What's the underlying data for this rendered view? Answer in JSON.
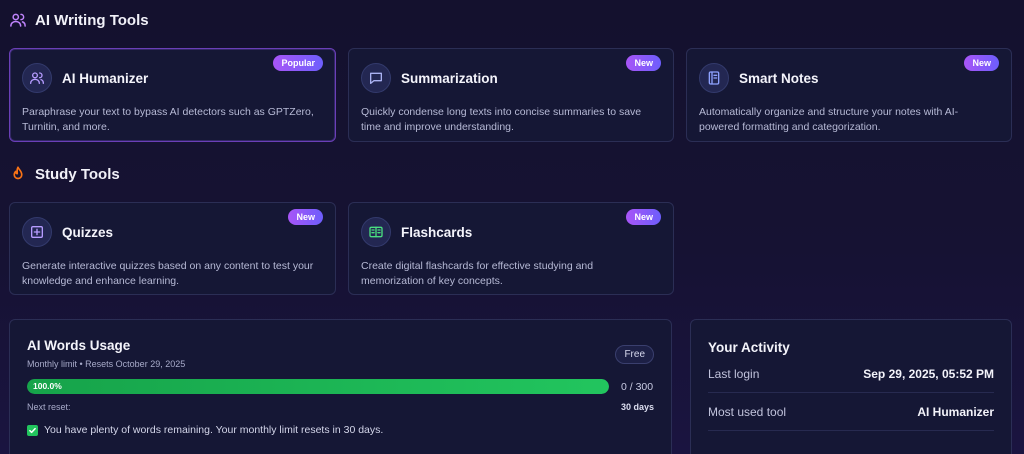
{
  "sections": {
    "writing": {
      "title": "AI Writing Tools",
      "icon": "users-icon"
    },
    "study": {
      "title": "Study Tools",
      "icon": "flame-icon"
    }
  },
  "writing_tools": [
    {
      "title": "AI Humanizer",
      "badge": "Popular",
      "icon": "users-icon",
      "description": "Paraphrase your text to bypass AI detectors such as GPTZero, Turnitin, and more."
    },
    {
      "title": "Summarization",
      "badge": "New",
      "icon": "chat-bubble-icon",
      "description": "Quickly condense long texts into concise summaries to save time and improve understanding."
    },
    {
      "title": "Smart Notes",
      "badge": "New",
      "icon": "notebook-icon",
      "description": "Automatically organize and structure your notes with AI-powered formatting and categorization."
    }
  ],
  "study_tools": [
    {
      "title": "Quizzes",
      "badge": "New",
      "icon": "quiz-grid-icon",
      "description": "Generate interactive quizzes based on any content to test your knowledge and enhance learning."
    },
    {
      "title": "Flashcards",
      "badge": "New",
      "icon": "book-open-icon",
      "description": "Create digital flashcards for effective studying and memorization of key concepts."
    }
  ],
  "usage": {
    "title": "AI Words Usage",
    "subtitle": "Monthly limit • Resets October 29, 2025",
    "plan": "Free",
    "progress_label": "100.0%",
    "progress_fraction": 1.0,
    "count": "0 / 300",
    "next_reset_label": "Next reset:",
    "next_reset_value": "30 days",
    "notice": "You have plenty of words remaining. Your monthly limit resets in 30 days."
  },
  "activity": {
    "title": "Your Activity",
    "rows": [
      {
        "key": "Last login",
        "value": "Sep 29, 2025, 05:52 PM"
      },
      {
        "key": "Most used tool",
        "value": "AI Humanizer"
      }
    ]
  },
  "colors": {
    "accent_purple": "#a855f7",
    "accent_indigo": "#6d5efc",
    "progress_green": "#22c55e",
    "background": "#14112e"
  }
}
